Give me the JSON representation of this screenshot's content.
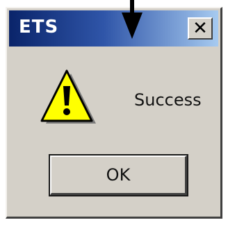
{
  "window": {
    "title": "ETS",
    "close_label": "✕"
  },
  "message": "Success",
  "buttons": {
    "ok_label": "OK"
  },
  "icons": {
    "warning": "warning-triangle-icon",
    "pointer": "pointer-arrow-icon"
  },
  "colors": {
    "title_gradient_start": "#0a246a",
    "title_gradient_end": "#a6caf0",
    "dialog_face": "#d4d0c8",
    "warning_yellow": "#ffff00"
  }
}
